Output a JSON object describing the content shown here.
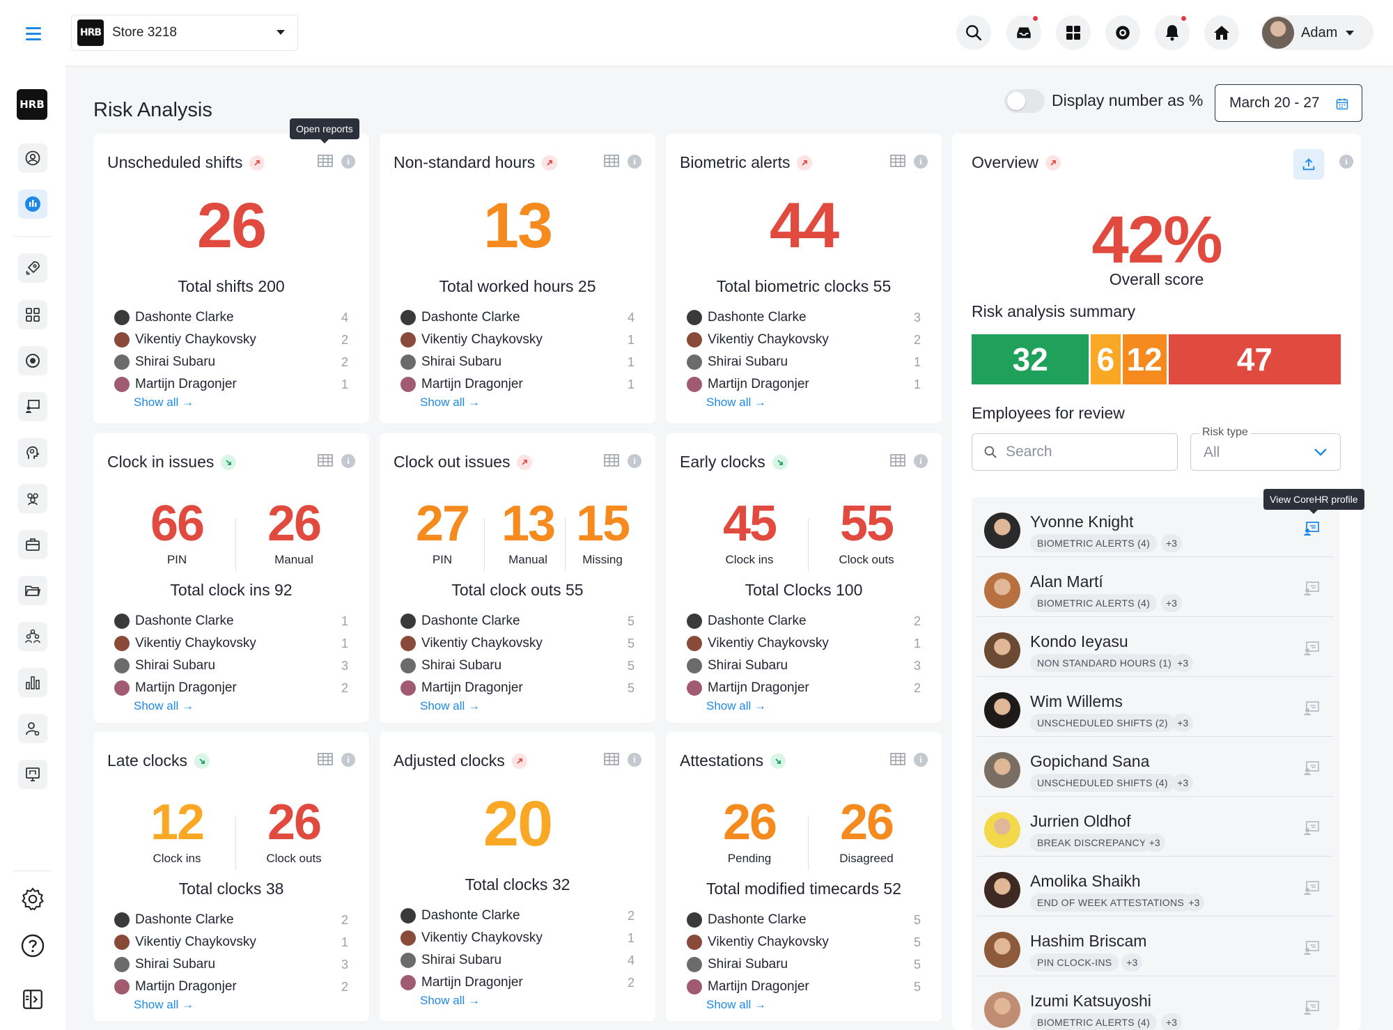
{
  "store": {
    "name": "Store 3218",
    "logo_text": "HRB"
  },
  "user": {
    "name": "Adam"
  },
  "page": {
    "title": "Risk Analysis",
    "toggle_label": "Display number as %",
    "date_range": "March 20 - 27"
  },
  "tooltips": {
    "open_reports": "Open reports",
    "view_profile": "View CoreHR profile"
  },
  "show_all_label": "Show all →",
  "cards": [
    {
      "title": "Unscheduled shifts",
      "trend": "up",
      "big": "26",
      "big_color": "red",
      "total": "Total shifts 200",
      "rows": [
        [
          "Dashonte Clarke",
          "4"
        ],
        [
          "Vikentiy Chaykovsky",
          "2"
        ],
        [
          "Shirai Subaru",
          "2"
        ],
        [
          "Martijn Dragonjer",
          "1"
        ]
      ]
    },
    {
      "title": "Non-standard hours",
      "trend": "up",
      "big": "13",
      "big_color": "orange",
      "total": "Total worked hours 25",
      "rows": [
        [
          "Dashonte Clarke",
          "4"
        ],
        [
          "Vikentiy Chaykovsky",
          "1"
        ],
        [
          "Shirai Subaru",
          "1"
        ],
        [
          "Martijn Dragonjer",
          "1"
        ]
      ]
    },
    {
      "title": "Biometric alerts",
      "trend": "up",
      "big": "44",
      "big_color": "red",
      "total": "Total biometric clocks 55",
      "rows": [
        [
          "Dashonte Clarke",
          "3"
        ],
        [
          "Vikentiy Chaykovsky",
          "2"
        ],
        [
          "Shirai Subaru",
          "1"
        ],
        [
          "Martijn Dragonjer",
          "1"
        ]
      ]
    },
    {
      "title": "Clock in issues",
      "trend": "down",
      "split": [
        [
          "66",
          "PIN",
          "red"
        ],
        [
          "26",
          "Manual",
          "red"
        ]
      ],
      "total": "Total clock ins 92",
      "rows": [
        [
          "Dashonte Clarke",
          "1"
        ],
        [
          "Vikentiy Chaykovsky",
          "1"
        ],
        [
          "Shirai Subaru",
          "3"
        ],
        [
          "Martijn Dragonjer",
          "2"
        ]
      ]
    },
    {
      "title": "Clock out issues",
      "trend": "up",
      "split": [
        [
          "27",
          "PIN",
          "orange"
        ],
        [
          "13",
          "Manual",
          "orange"
        ],
        [
          "15",
          "Missing",
          "orange"
        ]
      ],
      "total": "Total clock outs 55",
      "rows": [
        [
          "Dashonte Clarke",
          "5"
        ],
        [
          "Vikentiy Chaykovsky",
          "5"
        ],
        [
          "Shirai Subaru",
          "5"
        ],
        [
          "Martijn Dragonjer",
          "5"
        ]
      ]
    },
    {
      "title": "Early clocks",
      "trend": "down",
      "split": [
        [
          "45",
          "Clock ins",
          "red"
        ],
        [
          "55",
          "Clock outs",
          "red"
        ]
      ],
      "total": "Total Clocks 100",
      "rows": [
        [
          "Dashonte Clarke",
          "2"
        ],
        [
          "Vikentiy Chaykovsky",
          "1"
        ],
        [
          "Shirai Subaru",
          "3"
        ],
        [
          "Martijn Dragonjer",
          "2"
        ]
      ]
    },
    {
      "title": "Late clocks",
      "trend": "down",
      "split": [
        [
          "12",
          "Clock ins",
          "yellow"
        ],
        [
          "26",
          "Clock outs",
          "red"
        ]
      ],
      "total": "Total clocks 38",
      "rows": [
        [
          "Dashonte Clarke",
          "2"
        ],
        [
          "Vikentiy Chaykovsky",
          "1"
        ],
        [
          "Shirai Subaru",
          "3"
        ],
        [
          "Martijn Dragonjer",
          "2"
        ]
      ]
    },
    {
      "title": "Adjusted clocks",
      "trend": "up",
      "big": "20",
      "big_color": "yellow",
      "total": "Total clocks 32",
      "rows": [
        [
          "Dashonte Clarke",
          "2"
        ],
        [
          "Vikentiy Chaykovsky",
          "1"
        ],
        [
          "Shirai Subaru",
          "4"
        ],
        [
          "Martijn Dragonjer",
          "2"
        ]
      ]
    },
    {
      "title": "Attestations",
      "trend": "down",
      "split": [
        [
          "26",
          "Pending",
          "orange"
        ],
        [
          "26",
          "Disagreed",
          "orange"
        ]
      ],
      "total": "Total modified timecards 52",
      "rows": [
        [
          "Dashonte Clarke",
          "5"
        ],
        [
          "Vikentiy Chaykovsky",
          "5"
        ],
        [
          "Shirai Subaru",
          "5"
        ],
        [
          "Martijn Dragonjer",
          "5"
        ]
      ]
    }
  ],
  "overview": {
    "title": "Overview",
    "score": "42%",
    "score_label": "Overall score",
    "summary_title": "Risk analysis summary",
    "summary": [
      {
        "value": "32",
        "color": "#20a15b"
      },
      {
        "value": "6",
        "color": "#f9a825"
      },
      {
        "value": "12",
        "color": "#f58a1f"
      },
      {
        "value": "47",
        "color": "#e04a3f"
      }
    ],
    "review_title": "Employees for review",
    "search_placeholder": "Search",
    "risk_type_label": "Risk type",
    "risk_type_value": "All",
    "employees": [
      {
        "name": "Yvonne Knight",
        "tag": "BIOMETRIC ALERTS (4)",
        "more": "+3"
      },
      {
        "name": "Alan Martí",
        "tag": "BIOMETRIC ALERTS (4)",
        "more": "+3"
      },
      {
        "name": "Kondo Ieyasu",
        "tag": "NON STANDARD HOURS (1)",
        "more": "+3"
      },
      {
        "name": "Wim Willems",
        "tag": "UNSCHEDULED SHIFTS (2)",
        "more": "+3"
      },
      {
        "name": "Gopichand Sana",
        "tag": "UNSCHEDULED SHIFTS (4)",
        "more": "+3"
      },
      {
        "name": "Jurrien Oldhof",
        "tag": "BREAK DISCREPANCY",
        "more": "+3"
      },
      {
        "name": "Amolika Shaikh",
        "tag": "END OF WEEK ATTESTATIONS",
        "more": "+3"
      },
      {
        "name": "Hashim Briscam",
        "tag": "PIN CLOCK-INS",
        "more": "+3"
      },
      {
        "name": "Izumi Katsuyoshi",
        "tag": "BIOMETRIC ALERTS (4)",
        "more": "+3"
      }
    ]
  },
  "colors": {
    "red": "#e04a3f",
    "orange": "#f58a1f",
    "yellow": "#f9a825",
    "green": "#20a15b",
    "accent": "#1e88e5"
  }
}
